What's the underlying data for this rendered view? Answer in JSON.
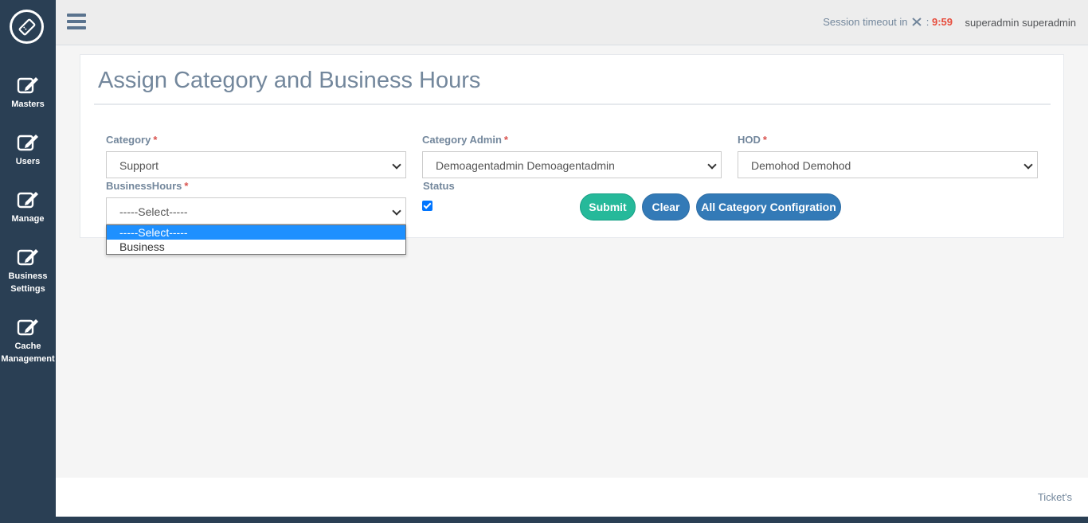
{
  "sidebar": {
    "logo_icon": "ticket-icon",
    "items": [
      {
        "label": "Masters",
        "icon": "edit-icon"
      },
      {
        "label": "Users",
        "icon": "edit-icon"
      },
      {
        "label": "Manage",
        "icon": "edit-icon"
      },
      {
        "label": "Business\nSettings",
        "icon": "edit-icon"
      },
      {
        "label": "Cache\nManagement",
        "icon": "edit-icon"
      }
    ]
  },
  "topbar": {
    "session_label": "Session timeout in",
    "session_separator": ":",
    "session_time": "9:59",
    "user": "superadmin superadmin"
  },
  "page": {
    "title": "Assign Category and Business Hours"
  },
  "form": {
    "category": {
      "label": "Category",
      "required": "*",
      "value": "Support"
    },
    "category_admin": {
      "label": "Category Admin",
      "required": "*",
      "value": "Demoagentadmin Demoagentadmin"
    },
    "hod": {
      "label": "HOD",
      "required": "*",
      "value": "Demohod Demohod"
    },
    "business_hours": {
      "label": "BusinessHours",
      "required": "*",
      "value": "-----Select-----",
      "options": [
        "-----Select-----",
        "Business"
      ]
    },
    "status": {
      "label": "Status",
      "checked": true
    }
  },
  "buttons": {
    "submit": "Submit",
    "clear": "Clear",
    "all_config": "All Category Configration"
  },
  "footer": {
    "text": "Ticket's"
  },
  "colors": {
    "sidebar": "#2a3f54",
    "success": "#26b99a",
    "primary": "#337ab7",
    "timer": "#e74c3c",
    "dropdown_highlight": "#1e90ff"
  }
}
